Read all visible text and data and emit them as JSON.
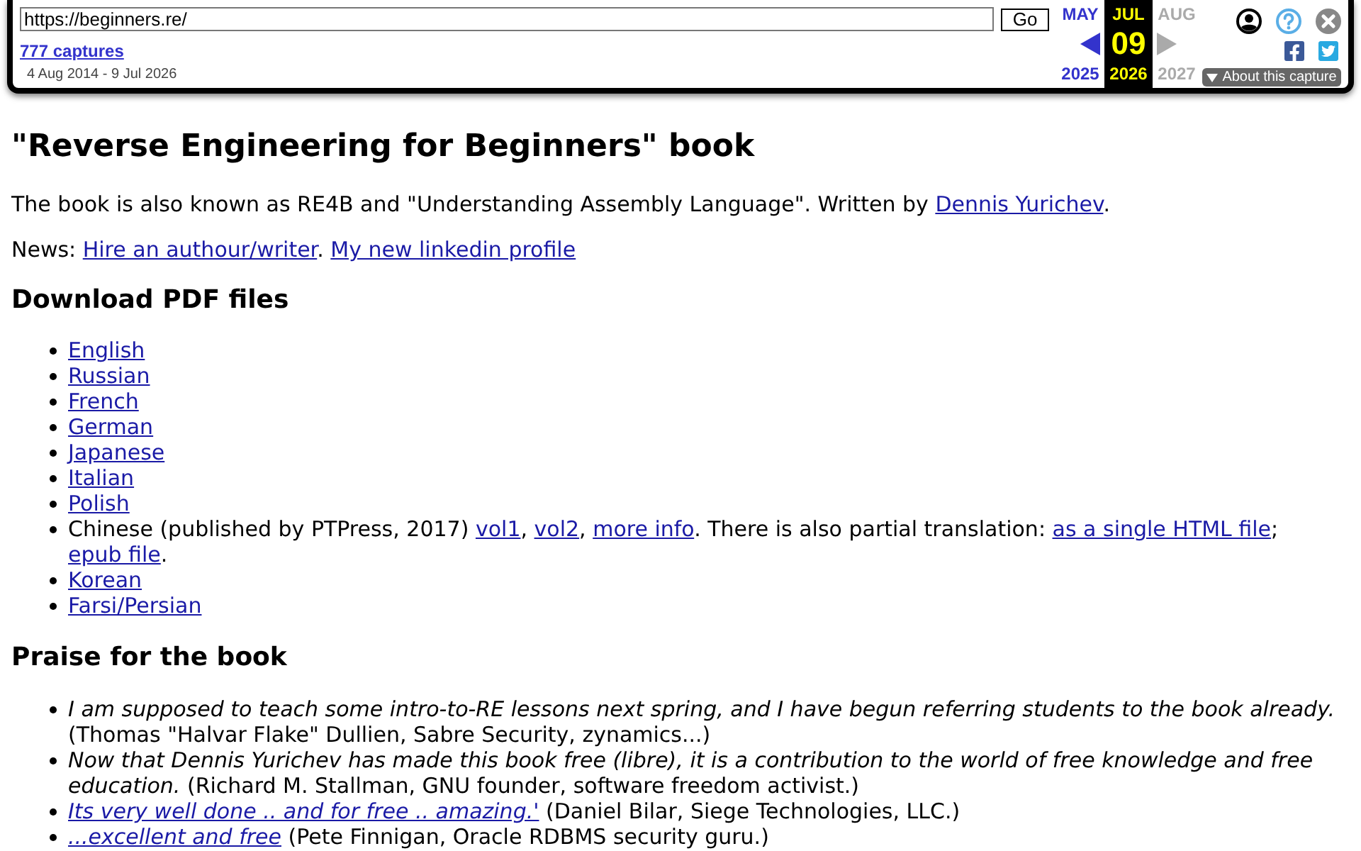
{
  "wayback_toolbar": {
    "url": "https://beginners.re/",
    "go_button": "Go",
    "captures_link": "777 captures",
    "date_range": "4 Aug 2014 - 9 Jul 2026",
    "calendar": [
      {
        "kind": "previous",
        "month": "MAY",
        "year": "2025",
        "selected": false,
        "disabled": false
      },
      {
        "kind": "current",
        "month": "JUL",
        "day": "09",
        "year": "2026",
        "selected": true,
        "disabled": false
      },
      {
        "kind": "next",
        "month": "AUG",
        "year": "2027",
        "selected": false,
        "disabled": true
      }
    ],
    "about_button": "About this capture"
  },
  "page": {
    "title": "\"Reverse Engineering for Beginners\" book",
    "intro": [
      {
        "kind": "text",
        "text": "The book is also known as RE4B and \"Understanding Assembly Language\". Written by "
      },
      {
        "kind": "link",
        "text": "Dennis Yurichev"
      },
      {
        "kind": "text",
        "text": "."
      }
    ],
    "news": [
      {
        "kind": "text",
        "text": "News: "
      },
      {
        "kind": "link",
        "text": "Hire an authour/writer"
      },
      {
        "kind": "text",
        "text": ". "
      },
      {
        "kind": "link",
        "text": "My new linkedin profile"
      }
    ],
    "downloads": {
      "heading": "Download PDF files",
      "items": [
        [
          {
            "kind": "link",
            "text": "English"
          }
        ],
        [
          {
            "kind": "link",
            "text": "Russian"
          }
        ],
        [
          {
            "kind": "link",
            "text": "French"
          }
        ],
        [
          {
            "kind": "link",
            "text": "German"
          }
        ],
        [
          {
            "kind": "link",
            "text": "Japanese"
          }
        ],
        [
          {
            "kind": "link",
            "text": "Italian"
          }
        ],
        [
          {
            "kind": "link",
            "text": "Polish"
          }
        ],
        [
          {
            "kind": "text",
            "text": "Chinese (published by PTPress, 2017) "
          },
          {
            "kind": "link",
            "text": "vol1"
          },
          {
            "kind": "text",
            "text": ", "
          },
          {
            "kind": "link",
            "text": "vol2"
          },
          {
            "kind": "text",
            "text": ", "
          },
          {
            "kind": "link",
            "text": "more info"
          },
          {
            "kind": "text",
            "text": ". There is also partial translation: "
          },
          {
            "kind": "link",
            "text": "as a single HTML file"
          },
          {
            "kind": "text",
            "text": "; "
          },
          {
            "kind": "link",
            "text": "epub file"
          },
          {
            "kind": "text",
            "text": "."
          }
        ],
        [
          {
            "kind": "link",
            "text": "Korean"
          }
        ],
        [
          {
            "kind": "link",
            "text": "Farsi/Persian"
          }
        ]
      ]
    },
    "praise": {
      "heading": "Praise for the book",
      "items": [
        [
          {
            "kind": "quote",
            "text": "I am supposed to teach some intro-to-RE lessons next spring, and I have begun referring students to the book already."
          },
          {
            "kind": "text",
            "text": " (Thomas \"Halvar Flake\" Dullien, Sabre Security, zynamics...)"
          }
        ],
        [
          {
            "kind": "quote",
            "text": "Now that Dennis Yurichev has made this book free (libre), it is a contribution to the world of free knowledge and free education."
          },
          {
            "kind": "text",
            "text": " (Richard M. Stallman, GNU founder, software freedom activist.)"
          }
        ],
        [
          {
            "kind": "quote_link",
            "text": "Its very well done .. and for free .. amazing.'"
          },
          {
            "kind": "text",
            "text": " (Daniel Bilar, Siege Technologies, LLC.)"
          }
        ],
        [
          {
            "kind": "quote_link",
            "text": "...excellent and free"
          },
          {
            "kind": "text",
            "text": " (Pete Finnigan, Oracle RDBMS security guru.)"
          }
        ]
      ]
    }
  }
}
